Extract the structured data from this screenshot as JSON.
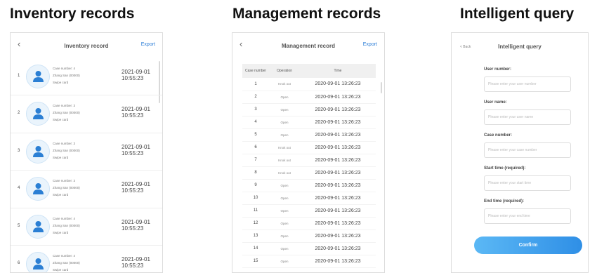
{
  "sections": {
    "inventory_title": "Inventory records",
    "management_title": "Management records",
    "query_title": "Intelligent query"
  },
  "inventory": {
    "back_icon": "chevron-left-icon",
    "title": "Inventory record",
    "export_label": "Export",
    "rows": [
      {
        "index": "1",
        "case": "Case number: 4",
        "user": "Zhang San (00000)",
        "action": "Swipe card",
        "date": "2021-09-01",
        "time": "10:55:23"
      },
      {
        "index": "2",
        "case": "Case number: 3",
        "user": "Zhang San (00000)",
        "action": "Swipe card",
        "date": "2021-09-01",
        "time": "10:55:23"
      },
      {
        "index": "3",
        "case": "Case number: 3",
        "user": "Zhang San (00000)",
        "action": "Swipe card",
        "date": "2021-09-01",
        "time": "10:55:23"
      },
      {
        "index": "4",
        "case": "Case number: 3",
        "user": "Zhang San (00000)",
        "action": "Swipe card",
        "date": "2021-09-01",
        "time": "10:55:23"
      },
      {
        "index": "5",
        "case": "Case number: 4",
        "user": "Zhang San (00000)",
        "action": "Swipe card",
        "date": "2021-09-01",
        "time": "10:55:23"
      },
      {
        "index": "6",
        "case": "Case number: 4",
        "user": "Zhang San (00000)",
        "action": "Swipe card",
        "date": "2021-09-01",
        "time": "10:55:23"
      }
    ]
  },
  "management": {
    "back_icon": "chevron-left-icon",
    "title": "Management record",
    "export_label": "Export",
    "columns": [
      "Case number",
      "Operation",
      "Time"
    ],
    "rows": [
      {
        "case": "1",
        "op": "Knok out",
        "time": "2020-09-01 13:26:23"
      },
      {
        "case": "2",
        "op": "Open",
        "time": "2020-09-01 13:26:23"
      },
      {
        "case": "3",
        "op": "Open",
        "time": "2020-09-01 13:26:23"
      },
      {
        "case": "4",
        "op": "Open",
        "time": "2020-09-01 13:26:23"
      },
      {
        "case": "5",
        "op": "Open",
        "time": "2020-09-01 13:26:23"
      },
      {
        "case": "6",
        "op": "Knok out",
        "time": "2020-09-01 13:26:23"
      },
      {
        "case": "7",
        "op": "Knok out",
        "time": "2020-09-01 13:26:23"
      },
      {
        "case": "8",
        "op": "Knok out",
        "time": "2020-09-01 13:26:23"
      },
      {
        "case": "9",
        "op": "Open",
        "time": "2020-09-01 13:26:23"
      },
      {
        "case": "10",
        "op": "Open",
        "time": "2020-09-01 13:26:23"
      },
      {
        "case": "11",
        "op": "Open",
        "time": "2020-09-01 13:26:23"
      },
      {
        "case": "12",
        "op": "Open",
        "time": "2020-09-01 13:26:23"
      },
      {
        "case": "13",
        "op": "Open",
        "time": "2020-09-01 13:26:23"
      },
      {
        "case": "14",
        "op": "Open",
        "time": "2020-09-01 13:26:23"
      },
      {
        "case": "15",
        "op": "Open",
        "time": "2020-09-01 13:26:23"
      }
    ]
  },
  "query": {
    "back_label": "< Back",
    "title": "Intelligent query",
    "fields": [
      {
        "label": "User number:",
        "placeholder": "Please enter your user number"
      },
      {
        "label": "User name:",
        "placeholder": "Please enter your user name"
      },
      {
        "label": "Case number:",
        "placeholder": "Please enter your case number"
      },
      {
        "label": "Start time (required):",
        "placeholder": "Please enter your start time"
      },
      {
        "label": "End time (required):",
        "placeholder": "Please enter your end time"
      }
    ],
    "confirm_label": "Confirm"
  },
  "colors": {
    "accent": "#2f8fe6",
    "avatar_icon": "#2b7fd4"
  }
}
